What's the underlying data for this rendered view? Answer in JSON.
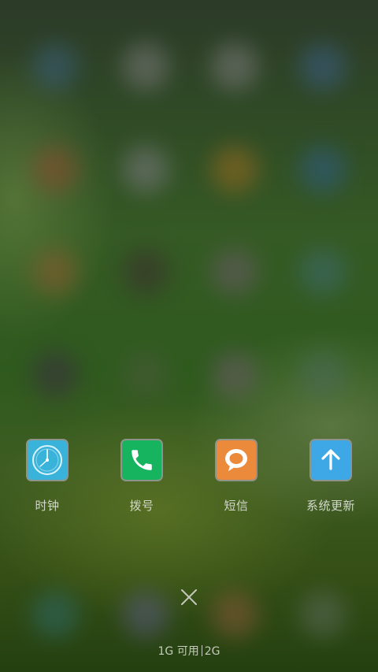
{
  "dock": {
    "apps": [
      {
        "label": "时钟",
        "icon": "clock-icon",
        "color": "#3ab3da"
      },
      {
        "label": "拨号",
        "icon": "phone-icon",
        "color": "#17b45f"
      },
      {
        "label": "短信",
        "icon": "message-icon",
        "color": "#ec8a3c"
      },
      {
        "label": "系统更新",
        "icon": "update-arrow-icon",
        "color": "#3ea7e6"
      }
    ]
  },
  "memory": {
    "available": "1G 可用",
    "total": "2G"
  },
  "close_icon": "close-icon"
}
